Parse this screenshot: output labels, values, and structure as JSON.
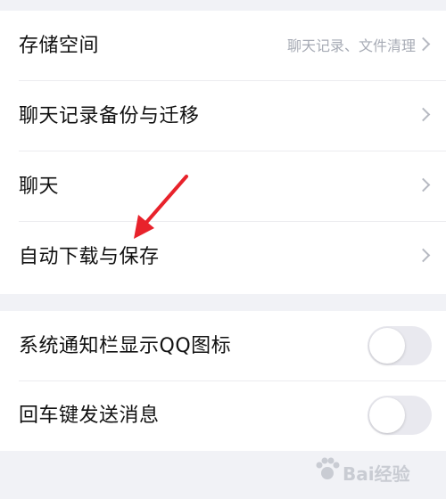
{
  "settings_group_1": [
    {
      "label": "存储空间",
      "value": "聊天记录、文件清理",
      "icon": "chevron-right-icon"
    },
    {
      "label": "聊天记录备份与迁移",
      "icon": "chevron-right-icon"
    },
    {
      "label": "聊天",
      "icon": "chevron-right-icon"
    },
    {
      "label": "自动下载与保存",
      "icon": "chevron-right-icon"
    }
  ],
  "settings_group_2": [
    {
      "label": "系统通知栏显示QQ图标",
      "toggle_on": false
    },
    {
      "label": "回车键发送消息",
      "toggle_on": false
    }
  ],
  "annotation": {
    "icon": "red-arrow-icon",
    "color": "#e8222b"
  },
  "watermark": {
    "text": "Bai经验",
    "color": "#c9ccd3"
  }
}
